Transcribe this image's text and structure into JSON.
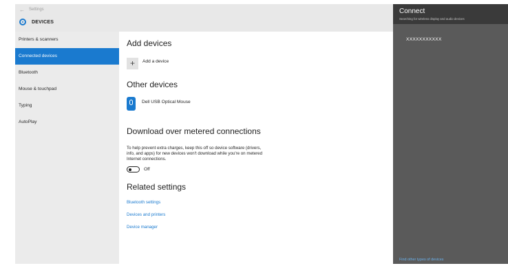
{
  "settings": {
    "back_label": "Settings",
    "page_title": "DEVICES",
    "sidebar": {
      "items": [
        {
          "label": "Printers & scanners"
        },
        {
          "label": "Connected devices"
        },
        {
          "label": "Bluetooth"
        },
        {
          "label": "Mouse & touchpad"
        },
        {
          "label": "Typing"
        },
        {
          "label": "AutoPlay"
        }
      ],
      "active_index": 1
    },
    "content": {
      "add_devices": {
        "title": "Add devices",
        "add_label": "Add a device"
      },
      "other_devices": {
        "title": "Other devices",
        "device_name": "Dell USB Optical Mouse"
      },
      "metered": {
        "title": "Download over metered connections",
        "description": "To help prevent extra charges, keep this off so device software (drivers, info, and apps) for new devices won't download while you're on metered Internet connections.",
        "toggle_state": "Off"
      },
      "related": {
        "title": "Related settings",
        "links": [
          "Bluetooth settings",
          "Devices and printers",
          "Device manager"
        ]
      }
    }
  },
  "connect": {
    "title": "Connect",
    "subtitle": "Searching for wireless display and audio devices",
    "device": "XXXXXXXXXXX",
    "footer_link": "Find other types of devices"
  },
  "colors": {
    "accent": "#1a7acf",
    "flyout_bg": "#5a5a5a",
    "flyout_header": "#3a3a3a",
    "sidebar_bg": "#ebebeb"
  }
}
